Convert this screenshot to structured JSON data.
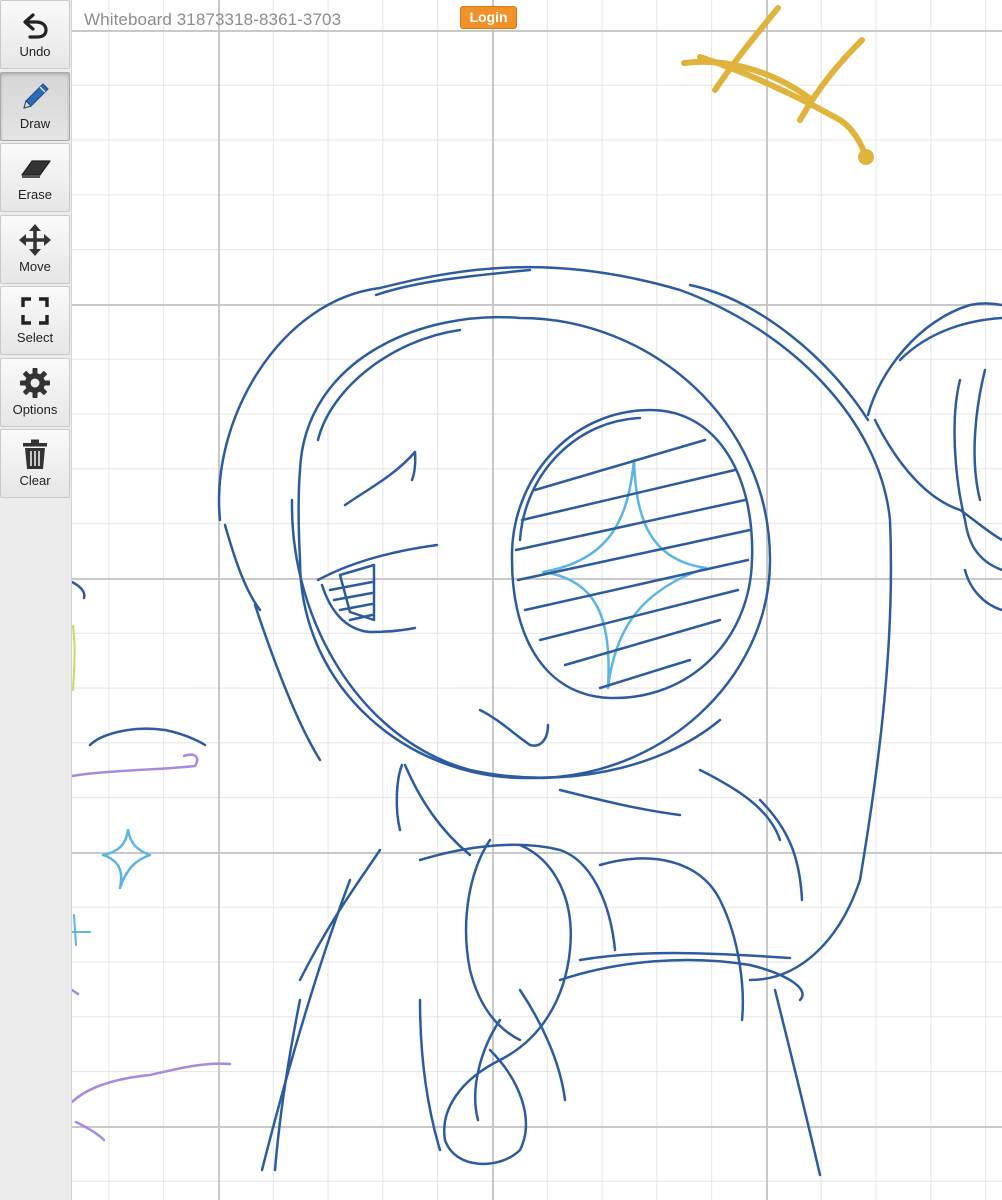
{
  "app": {
    "title": "Whiteboard 31873318-8361-3703",
    "login_label": "Login"
  },
  "toolbar": {
    "active_tool": "Draw",
    "tools": [
      {
        "label": "Undo",
        "icon": "undo-icon"
      },
      {
        "label": "Draw",
        "icon": "pencil-icon"
      },
      {
        "label": "Erase",
        "icon": "eraser-icon"
      },
      {
        "label": "Move",
        "icon": "move-arrows-icon"
      },
      {
        "label": "Select",
        "icon": "select-frame-icon"
      },
      {
        "label": "Options",
        "icon": "gear-icon"
      },
      {
        "label": "Clear",
        "icon": "trash-icon"
      }
    ]
  },
  "colors": {
    "ink_dark_blue": "#2d5c9e",
    "ink_light_blue": "#5ab4e6",
    "ink_gold": "#e0b43c",
    "ink_purple": "#a889dc",
    "ink_lime": "#c4dc5a",
    "login_orange": "#f0912a",
    "toolbar_bg": "#ececec",
    "grid_line": "#c4c4c4"
  }
}
